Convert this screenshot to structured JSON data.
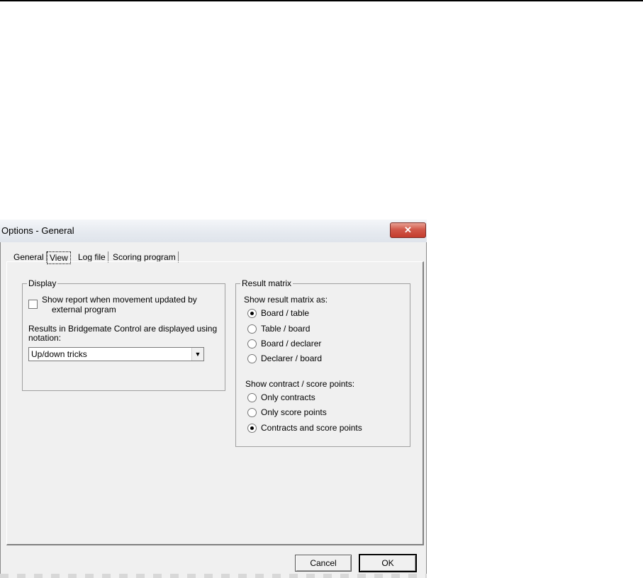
{
  "window": {
    "title": "Options - General",
    "close_glyph": "✕"
  },
  "tabs": [
    {
      "label": "General"
    },
    {
      "label": "View"
    },
    {
      "label": "Log file"
    },
    {
      "label": "Scoring program"
    }
  ],
  "display": {
    "group_label": "Display",
    "checkbox_label_line1": "Show report when movement updated by",
    "checkbox_label_line2": "external program",
    "checkbox_checked": false,
    "notation_label_line1": "Results in Bridgemate Control are displayed using",
    "notation_label_line2": "notation:",
    "notation_value": "Up/down tricks",
    "dropdown_glyph": "▼"
  },
  "result_matrix": {
    "group_label": "Result matrix",
    "show_as_label": "Show result matrix as:",
    "options": [
      {
        "label": "Board / table",
        "checked": true
      },
      {
        "label": "Table / board",
        "checked": false
      },
      {
        "label": "Board / declarer",
        "checked": false
      },
      {
        "label": "Declarer / board",
        "checked": false
      }
    ],
    "show_points_label": "Show contract / score points:",
    "points_options": [
      {
        "label": "Only contracts",
        "checked": false
      },
      {
        "label": "Only score points",
        "checked": false
      },
      {
        "label": "Contracts and score points",
        "checked": true
      }
    ]
  },
  "buttons": {
    "cancel": "Cancel",
    "ok": "OK"
  }
}
